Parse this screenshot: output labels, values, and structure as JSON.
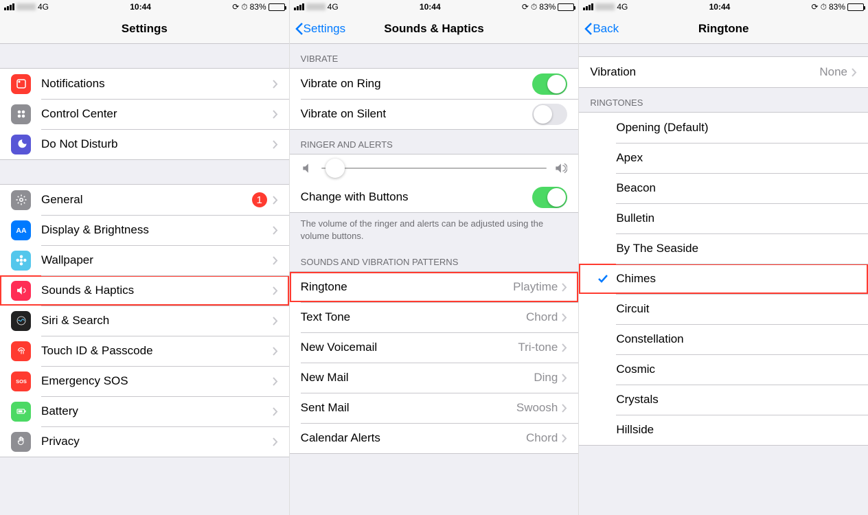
{
  "status": {
    "carrier": "4G",
    "time": "10:44",
    "battery": "83%"
  },
  "panel1": {
    "title": "Settings",
    "group1": [
      {
        "label": "Notifications",
        "color": "#ff3b30",
        "icon": "notifications"
      },
      {
        "label": "Control Center",
        "color": "#8e8e93",
        "icon": "control-center"
      },
      {
        "label": "Do Not Disturb",
        "color": "#5856d6",
        "icon": "moon"
      }
    ],
    "group2": [
      {
        "label": "General",
        "color": "#8e8e93",
        "icon": "gear",
        "badge": "1"
      },
      {
        "label": "Display & Brightness",
        "color": "#007aff",
        "icon": "aa"
      },
      {
        "label": "Wallpaper",
        "color": "#54c7ec",
        "icon": "flower"
      },
      {
        "label": "Sounds & Haptics",
        "color": "#ff2d55",
        "icon": "speaker",
        "highlight": true
      },
      {
        "label": "Siri & Search",
        "color": "#222",
        "icon": "siri"
      },
      {
        "label": "Touch ID & Passcode",
        "color": "#ff3b30",
        "icon": "fingerprint"
      },
      {
        "label": "Emergency SOS",
        "color": "#ff3b30",
        "icon": "sos"
      },
      {
        "label": "Battery",
        "color": "#4cd964",
        "icon": "battery"
      },
      {
        "label": "Privacy",
        "color": "#8e8e93",
        "icon": "hand"
      }
    ]
  },
  "panel2": {
    "back": "Settings",
    "title": "Sounds & Haptics",
    "sections": {
      "vibrate": {
        "header": "VIBRATE",
        "items": [
          {
            "label": "Vibrate on Ring",
            "on": true
          },
          {
            "label": "Vibrate on Silent",
            "on": false
          }
        ]
      },
      "ringer": {
        "header": "RINGER AND ALERTS",
        "change_label": "Change with Buttons",
        "footer": "The volume of the ringer and alerts can be adjusted using the volume buttons."
      },
      "sounds": {
        "header": "SOUNDS AND VIBRATION PATTERNS",
        "items": [
          {
            "label": "Ringtone",
            "value": "Playtime",
            "highlight": true
          },
          {
            "label": "Text Tone",
            "value": "Chord"
          },
          {
            "label": "New Voicemail",
            "value": "Tri-tone"
          },
          {
            "label": "New Mail",
            "value": "Ding"
          },
          {
            "label": "Sent Mail",
            "value": "Swoosh"
          },
          {
            "label": "Calendar Alerts",
            "value": "Chord"
          }
        ]
      }
    }
  },
  "panel3": {
    "back": "Back",
    "title": "Ringtone",
    "vibration": {
      "label": "Vibration",
      "value": "None"
    },
    "ringtones_header": "RINGTONES",
    "ringtones": [
      {
        "label": "Opening (Default)"
      },
      {
        "label": "Apex"
      },
      {
        "label": "Beacon"
      },
      {
        "label": "Bulletin"
      },
      {
        "label": "By The Seaside"
      },
      {
        "label": "Chimes",
        "selected": true,
        "highlight": true
      },
      {
        "label": "Circuit"
      },
      {
        "label": "Constellation"
      },
      {
        "label": "Cosmic"
      },
      {
        "label": "Crystals"
      },
      {
        "label": "Hillside"
      }
    ]
  }
}
